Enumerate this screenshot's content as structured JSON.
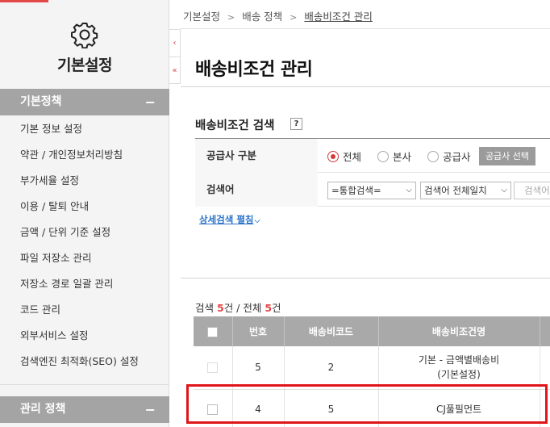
{
  "sidebar": {
    "title": "기본설정",
    "sections": [
      {
        "label": "기본정책",
        "toggle": "−"
      },
      {
        "label": "관리 정책",
        "toggle": "−"
      }
    ],
    "items": [
      {
        "label": "기본 정보 설정"
      },
      {
        "label": "약관 / 개인정보처리방침"
      },
      {
        "label": "부가세율 설정"
      },
      {
        "label": "이용 / 탈퇴 안내"
      },
      {
        "label": "금액 / 단위 기준 설정"
      },
      {
        "label": "파일 저장소 관리"
      },
      {
        "label": "저장소 경로 일괄 관리"
      },
      {
        "label": "코드 관리"
      },
      {
        "label": "외부서비스 설정"
      },
      {
        "label": "검색엔진 최적화(SEO) 설정"
      }
    ]
  },
  "collapse": {
    "collapse_glyph": "‹",
    "top_glyph": "«"
  },
  "breadcrumb": {
    "items": [
      "기본설정",
      "배송 정책",
      "배송비조건 관리"
    ],
    "separator": ">"
  },
  "page": {
    "title": "배송비조건 관리"
  },
  "search": {
    "title": "배송비조건 검색",
    "help": "?",
    "supplier_label": "공급사 구분",
    "radios": [
      {
        "label": "전체",
        "checked": true
      },
      {
        "label": "본사",
        "checked": false
      },
      {
        "label": "공급사",
        "checked": false
      }
    ],
    "supplier_button": "공급사 선택",
    "keyword_label": "검색어",
    "select_type": "=통합검색=",
    "select_match": "검색어 전체일치",
    "keyword_placeholder": "검색어",
    "detail_link": "상세검색 펼침"
  },
  "results": {
    "prefix": "검색 ",
    "found": "5",
    "mid": "건 / 전체 ",
    "total": "5",
    "suffix": "건",
    "columns": [
      "번호",
      "배송비코드",
      "배송비조건명"
    ],
    "rows": [
      {
        "no": "5",
        "code": "2",
        "name_line1": "기본 - 금액별배송비",
        "name_line2": "(기본설정)"
      },
      {
        "no": "4",
        "code": "5",
        "name_line1": "CJ풀필먼트",
        "name_line2": ""
      }
    ]
  },
  "colors": {
    "accent": "#e24848",
    "highlight": "#e0161a",
    "link": "#2a74c8",
    "header_gray": "#a9a9a9"
  }
}
